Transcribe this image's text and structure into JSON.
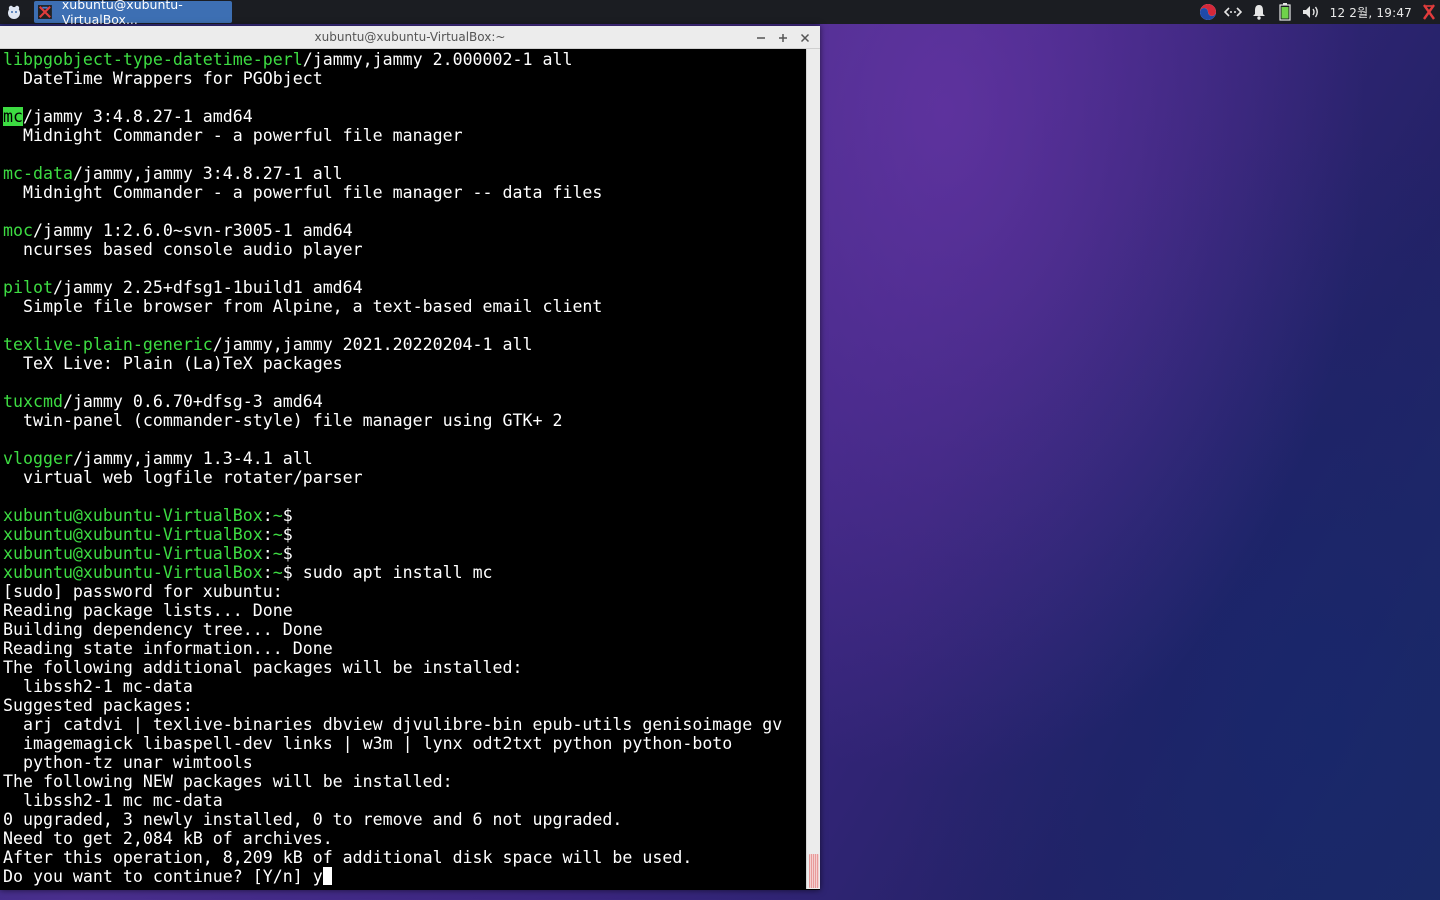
{
  "panel": {
    "task_label": "xubuntu@xubuntu-VirtualBox...",
    "clock": "12 2월, 19:47",
    "tray_icons": [
      "input-method-icon",
      "network-icon",
      "notification-bell-icon",
      "battery-icon",
      "volume-icon",
      "xfce-logo-icon"
    ]
  },
  "window": {
    "title": "xubuntu@xubuntu-VirtualBox:~",
    "buttons": [
      "minimize",
      "maximize",
      "close"
    ]
  },
  "terminal": {
    "prompt_user": "xubuntu@xubuntu-VirtualBox",
    "prompt_path": "~",
    "lines": [
      {
        "segments": [
          {
            "t": "libpgobject-type-datetime-perl",
            "c": "g"
          },
          {
            "t": "/jammy,jammy 2.000002-1 all"
          }
        ]
      },
      {
        "segments": [
          {
            "t": "  DateTime Wrappers for PGObject"
          }
        ]
      },
      {
        "segments": [
          {
            "t": ""
          }
        ]
      },
      {
        "segments": [
          {
            "t": "mc",
            "c": "hl"
          },
          {
            "t": "/jammy 3:4.8.27-1 amd64"
          }
        ]
      },
      {
        "segments": [
          {
            "t": "  Midnight Commander - a powerful file manager"
          }
        ]
      },
      {
        "segments": [
          {
            "t": ""
          }
        ]
      },
      {
        "segments": [
          {
            "t": "mc-data",
            "c": "g"
          },
          {
            "t": "/jammy,jammy 3:4.8.27-1 all"
          }
        ]
      },
      {
        "segments": [
          {
            "t": "  Midnight Commander - a powerful file manager -- data files"
          }
        ]
      },
      {
        "segments": [
          {
            "t": ""
          }
        ]
      },
      {
        "segments": [
          {
            "t": "moc",
            "c": "g"
          },
          {
            "t": "/jammy 1:2.6.0~svn-r3005-1 amd64"
          }
        ]
      },
      {
        "segments": [
          {
            "t": "  ncurses based console audio player"
          }
        ]
      },
      {
        "segments": [
          {
            "t": ""
          }
        ]
      },
      {
        "segments": [
          {
            "t": "pilot",
            "c": "g"
          },
          {
            "t": "/jammy 2.25+dfsg1-1build1 amd64"
          }
        ]
      },
      {
        "segments": [
          {
            "t": "  Simple file browser from Alpine, a text-based email client"
          }
        ]
      },
      {
        "segments": [
          {
            "t": ""
          }
        ]
      },
      {
        "segments": [
          {
            "t": "texlive-plain-generic",
            "c": "g"
          },
          {
            "t": "/jammy,jammy 2021.20220204-1 all"
          }
        ]
      },
      {
        "segments": [
          {
            "t": "  TeX Live: Plain (La)TeX packages"
          }
        ]
      },
      {
        "segments": [
          {
            "t": ""
          }
        ]
      },
      {
        "segments": [
          {
            "t": "tuxcmd",
            "c": "g"
          },
          {
            "t": "/jammy 0.6.70+dfsg-3 amd64"
          }
        ]
      },
      {
        "segments": [
          {
            "t": "  twin-panel (commander-style) file manager using GTK+ 2"
          }
        ]
      },
      {
        "segments": [
          {
            "t": ""
          }
        ]
      },
      {
        "segments": [
          {
            "t": "vlogger",
            "c": "g"
          },
          {
            "t": "/jammy,jammy 1.3-4.1 all"
          }
        ]
      },
      {
        "segments": [
          {
            "t": "  virtual web logfile rotater/parser"
          }
        ]
      },
      {
        "segments": [
          {
            "t": ""
          }
        ]
      },
      {
        "segments": [
          {
            "t": "xubuntu@xubuntu-VirtualBox",
            "c": "g"
          },
          {
            "t": ":"
          },
          {
            "t": "~",
            "c": "g"
          },
          {
            "t": "$"
          }
        ]
      },
      {
        "segments": [
          {
            "t": "xubuntu@xubuntu-VirtualBox",
            "c": "g"
          },
          {
            "t": ":"
          },
          {
            "t": "~",
            "c": "g"
          },
          {
            "t": "$"
          }
        ]
      },
      {
        "segments": [
          {
            "t": "xubuntu@xubuntu-VirtualBox",
            "c": "g"
          },
          {
            "t": ":"
          },
          {
            "t": "~",
            "c": "g"
          },
          {
            "t": "$"
          }
        ]
      },
      {
        "segments": [
          {
            "t": "xubuntu@xubuntu-VirtualBox",
            "c": "g"
          },
          {
            "t": ":"
          },
          {
            "t": "~",
            "c": "g"
          },
          {
            "t": "$ sudo apt install mc"
          }
        ]
      },
      {
        "segments": [
          {
            "t": "[sudo] password for xubuntu:"
          }
        ]
      },
      {
        "segments": [
          {
            "t": "Reading package lists... Done"
          }
        ]
      },
      {
        "segments": [
          {
            "t": "Building dependency tree... Done"
          }
        ]
      },
      {
        "segments": [
          {
            "t": "Reading state information... Done"
          }
        ]
      },
      {
        "segments": [
          {
            "t": "The following additional packages will be installed:"
          }
        ]
      },
      {
        "segments": [
          {
            "t": "  libssh2-1 mc-data"
          }
        ]
      },
      {
        "segments": [
          {
            "t": "Suggested packages:"
          }
        ]
      },
      {
        "segments": [
          {
            "t": "  arj catdvi | texlive-binaries dbview djvulibre-bin epub-utils genisoimage gv"
          }
        ]
      },
      {
        "segments": [
          {
            "t": "  imagemagick libaspell-dev links | w3m | lynx odt2txt python python-boto"
          }
        ]
      },
      {
        "segments": [
          {
            "t": "  python-tz unar wimtools"
          }
        ]
      },
      {
        "segments": [
          {
            "t": "The following NEW packages will be installed:"
          }
        ]
      },
      {
        "segments": [
          {
            "t": "  libssh2-1 mc mc-data"
          }
        ]
      },
      {
        "segments": [
          {
            "t": "0 upgraded, 3 newly installed, 0 to remove and 6 not upgraded."
          }
        ]
      },
      {
        "segments": [
          {
            "t": "Need to get 2,084 kB of archives."
          }
        ]
      },
      {
        "segments": [
          {
            "t": "After this operation, 8,209 kB of additional disk space will be used."
          }
        ]
      },
      {
        "segments": [
          {
            "t": "Do you want to continue? [Y/n] y"
          }
        ],
        "cursor": true
      }
    ]
  },
  "colors": {
    "terminal_bg": "#000000",
    "terminal_fg": "#ffffff",
    "accent_green": "#3ddc42",
    "task_button": "#3d6fb3"
  }
}
